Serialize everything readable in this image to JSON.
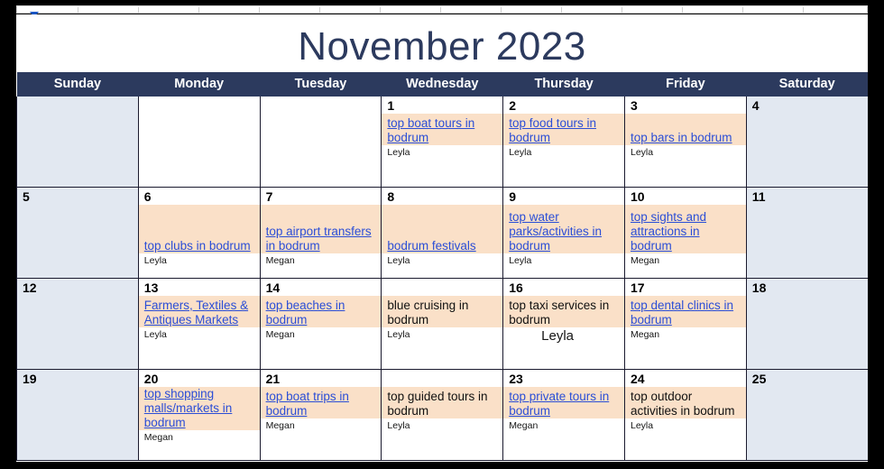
{
  "document": {
    "title": "November 2023"
  },
  "ruler": {
    "indent_marker": "left-indent-marker"
  },
  "calendar": {
    "weekday_headers": [
      "Sunday",
      "Monday",
      "Tuesday",
      "Wednesday",
      "Thursday",
      "Friday",
      "Saturday"
    ],
    "colors": {
      "header_bar": "#2c3a5e",
      "title_text": "#2c3a5e",
      "weekend_cell": "#e2e8f1",
      "event_band": "#fae0c8",
      "link_text": "#2b4ed6",
      "grid_line": "#1a1a2e"
    },
    "weeks": [
      {
        "days": [
          {
            "num": "",
            "weekend": true,
            "blank": false,
            "events": []
          },
          {
            "num": "",
            "weekend": false,
            "blank": false,
            "events": []
          },
          {
            "num": "",
            "weekend": false,
            "blank": false,
            "events": []
          },
          {
            "num": "1",
            "weekend": false,
            "blank": false,
            "events": [
              {
                "title": "top boat tours in bodrum",
                "link": true,
                "person": "Leyla",
                "tall": false,
                "emphasis": false
              }
            ]
          },
          {
            "num": "2",
            "weekend": false,
            "blank": false,
            "events": [
              {
                "title": "top food tours in bodrum",
                "link": true,
                "person": "Leyla",
                "tall": false,
                "emphasis": false
              }
            ]
          },
          {
            "num": "3",
            "weekend": false,
            "blank": false,
            "events": [
              {
                "title": "top bars in bodrum",
                "link": true,
                "person": "Leyla",
                "tall": false,
                "emphasis": false
              }
            ]
          },
          {
            "num": "4",
            "weekend": true,
            "blank": false,
            "events": []
          }
        ]
      },
      {
        "days": [
          {
            "num": "5",
            "weekend": true,
            "blank": false,
            "events": []
          },
          {
            "num": "6",
            "weekend": false,
            "blank": false,
            "events": [
              {
                "title": "top clubs in bodrum",
                "link": true,
                "person": "Leyla",
                "tall": true,
                "emphasis": false
              }
            ]
          },
          {
            "num": "7",
            "weekend": false,
            "blank": false,
            "events": [
              {
                "title": "top airport transfers in bodrum",
                "link": true,
                "person": "Megan",
                "tall": true,
                "emphasis": false
              }
            ]
          },
          {
            "num": "8",
            "weekend": false,
            "blank": false,
            "events": [
              {
                "title": "bodrum festivals",
                "link": true,
                "person": "Leyla",
                "tall": true,
                "emphasis": false
              }
            ]
          },
          {
            "num": "9",
            "weekend": false,
            "blank": false,
            "events": [
              {
                "title": "top water parks/activities in bodrum",
                "link": true,
                "person": "Leyla",
                "tall": true,
                "emphasis": false
              }
            ]
          },
          {
            "num": "10",
            "weekend": false,
            "blank": false,
            "events": [
              {
                "title": "top sights and attractions in bodrum",
                "link": true,
                "person": "Megan",
                "tall": true,
                "emphasis": false
              }
            ]
          },
          {
            "num": "11",
            "weekend": true,
            "blank": false,
            "events": []
          }
        ]
      },
      {
        "days": [
          {
            "num": "12",
            "weekend": true,
            "blank": false,
            "events": []
          },
          {
            "num": "13",
            "weekend": false,
            "blank": false,
            "events": [
              {
                "title": "Farmers, Textiles & Antiques Markets",
                "link": true,
                "person": "Leyla",
                "tall": false,
                "emphasis": false
              }
            ]
          },
          {
            "num": "14",
            "weekend": false,
            "blank": false,
            "events": [
              {
                "title": "top beaches in bodrum",
                "link": true,
                "person": "Megan",
                "tall": false,
                "emphasis": false
              }
            ]
          },
          {
            "num": "",
            "weekend": false,
            "blank": false,
            "events": [
              {
                "title": "blue cruising in bodrum",
                "link": false,
                "person": "Leyla",
                "tall": false,
                "emphasis": false
              }
            ]
          },
          {
            "num": "16",
            "weekend": false,
            "blank": false,
            "events": [
              {
                "title": "top taxi services in bodrum",
                "link": false,
                "person": "Leyla",
                "tall": false,
                "emphasis": true
              }
            ]
          },
          {
            "num": "17",
            "weekend": false,
            "blank": false,
            "events": [
              {
                "title": "top dental clinics in bodrum",
                "link": true,
                "person": "Megan",
                "tall": false,
                "emphasis": false
              }
            ]
          },
          {
            "num": "18",
            "weekend": true,
            "blank": false,
            "events": []
          }
        ]
      },
      {
        "days": [
          {
            "num": "19",
            "weekend": true,
            "blank": false,
            "events": []
          },
          {
            "num": "20",
            "weekend": false,
            "blank": false,
            "events": [
              {
                "title": "top shopping malls/markets in bodrum",
                "link": true,
                "person": "Megan",
                "tall": false,
                "emphasis": false
              }
            ]
          },
          {
            "num": "21",
            "weekend": false,
            "blank": false,
            "events": [
              {
                "title": "top boat trips in bodrum",
                "link": true,
                "person": "Megan",
                "tall": false,
                "emphasis": false
              }
            ]
          },
          {
            "num": "",
            "weekend": false,
            "blank": false,
            "events": [
              {
                "title": "top guided tours in bodrum",
                "link": false,
                "person": "Leyla",
                "tall": false,
                "emphasis": false
              }
            ]
          },
          {
            "num": "23",
            "weekend": false,
            "blank": false,
            "events": [
              {
                "title": "top private tours in bodrum",
                "link": true,
                "person": "Megan",
                "tall": false,
                "emphasis": false
              }
            ]
          },
          {
            "num": "24",
            "weekend": false,
            "blank": false,
            "events": [
              {
                "title": "top outdoor activities in bodrum",
                "link": false,
                "person": "Leyla",
                "tall": false,
                "emphasis": false
              }
            ]
          },
          {
            "num": "25",
            "weekend": true,
            "blank": false,
            "events": []
          }
        ]
      }
    ]
  }
}
